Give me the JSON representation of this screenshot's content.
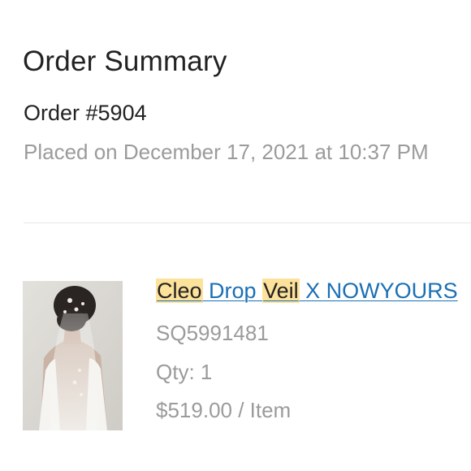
{
  "summary": {
    "title": "Order Summary",
    "order_number": "Order #5904",
    "placed": "Placed on December 17, 2021 at 10:37 PM"
  },
  "item": {
    "name_parts": [
      "Cleo",
      "Drop",
      "Veil",
      "X NOWYOURS"
    ],
    "sku": "SQ5991481",
    "qty": "Qty: 1",
    "price": "$519.00 / Item",
    "image_alt": "bride-veil-photo"
  },
  "colors": {
    "text": "#222222",
    "muted": "#9b9b9b",
    "link": "#1a6fb5",
    "highlight": "#fde29b",
    "divider": "#e6e6e6"
  }
}
